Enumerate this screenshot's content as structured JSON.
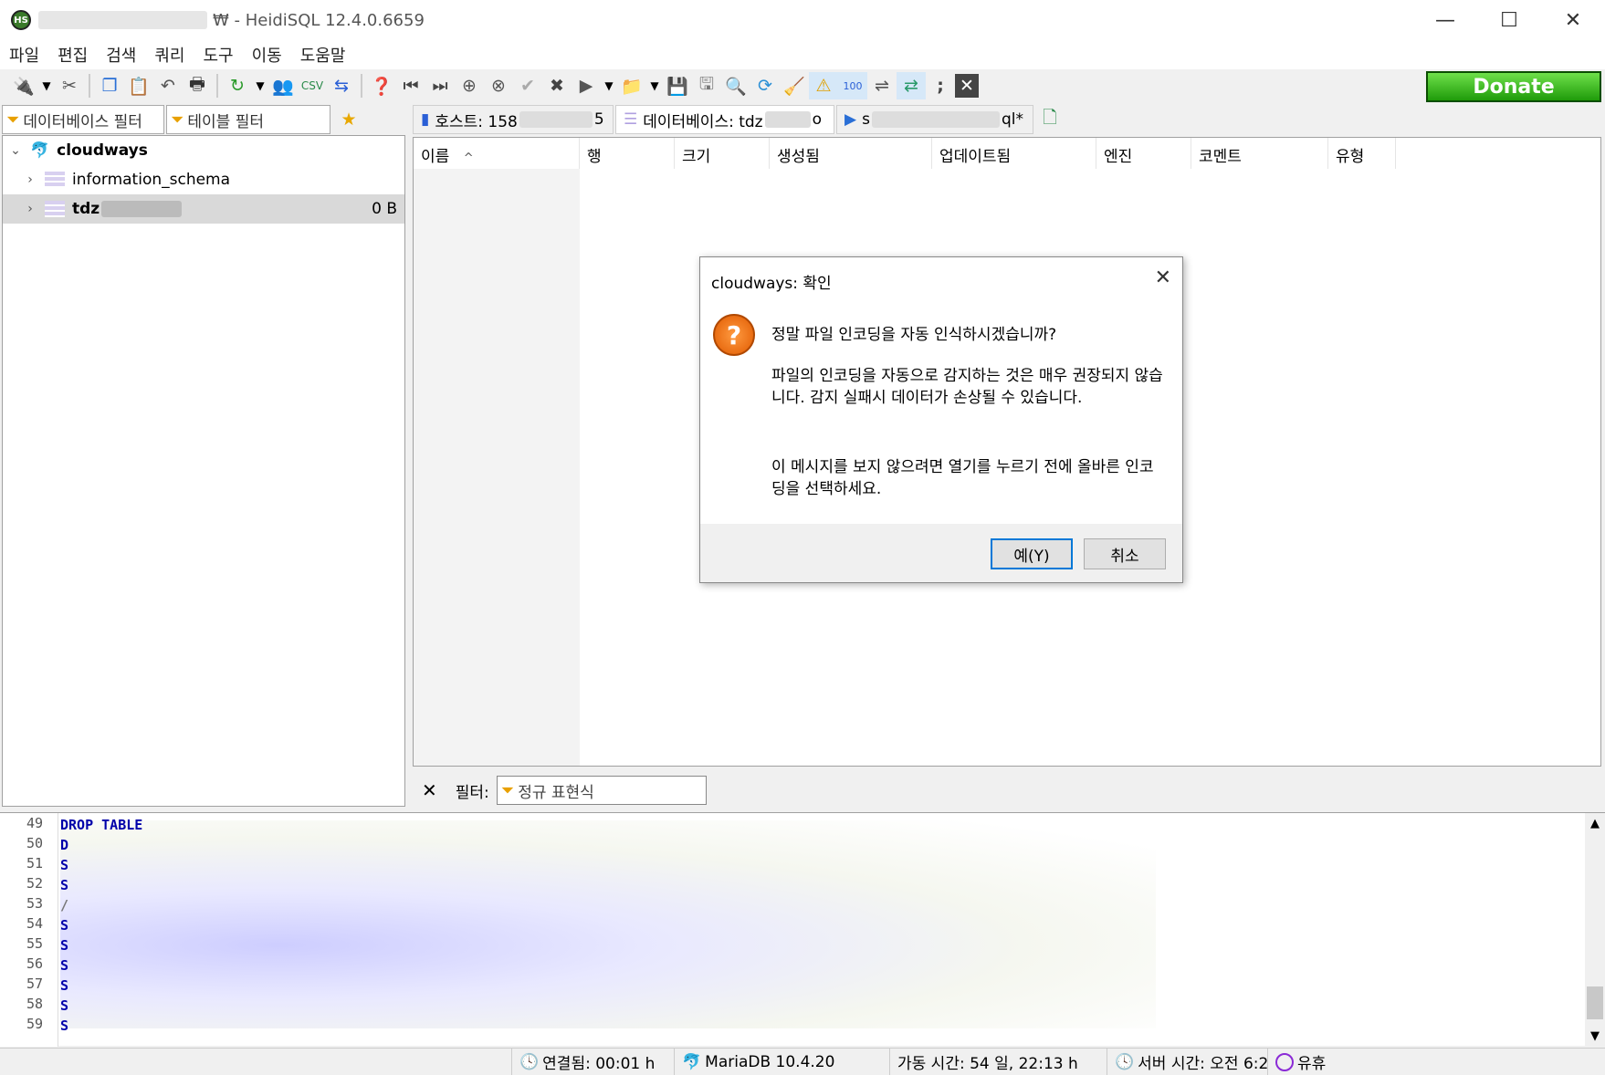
{
  "window": {
    "title": "₩ - HeidiSQL 12.4.0.6659",
    "app_icon_text": "HS",
    "minimize": "—",
    "maximize": "☐",
    "close": "✕"
  },
  "menu": [
    "파일",
    "편집",
    "검색",
    "쿼리",
    "도구",
    "이동",
    "도움말"
  ],
  "toolbar": {
    "donate_label": "Donate"
  },
  "filters": {
    "db_filter": "데이터베이스 필터",
    "table_filter": "테이블 필터"
  },
  "tree": {
    "root": "cloudways",
    "items": [
      {
        "label": "information_schema",
        "size": ""
      },
      {
        "label": "tdz",
        "size": "0 B"
      }
    ]
  },
  "tabs": [
    {
      "prefix": "호스트: 158",
      "suffix": "5"
    },
    {
      "prefix": "데이터베이스: tdz",
      "suffix": "o"
    },
    {
      "prefix": "s",
      "suffix": "ql*"
    }
  ],
  "grid": {
    "columns": [
      "이름",
      "행",
      "크기",
      "생성됨",
      "업데이트됨",
      "엔진",
      "코멘트",
      "유형"
    ],
    "sort_indicator": "^"
  },
  "grid_filter": {
    "label": "필터:",
    "placeholder": "정규 표현식",
    "close": "✕"
  },
  "editor": {
    "line_numbers": [
      "49",
      "50",
      "51",
      "52",
      "53",
      "54",
      "55",
      "56",
      "57",
      "58",
      "59"
    ],
    "first_chars": [
      "DROP TABLE",
      "D",
      "S",
      "S",
      "/",
      "S",
      "S",
      "S",
      "S",
      "S",
      "S"
    ]
  },
  "status": {
    "connected": "연결됨: 00:01 h",
    "server": "MariaDB 10.4.20",
    "uptime": "가동 시간: 54 일, 22:13 h",
    "server_time": "서버 시간: 오전 6:2",
    "idle": "유휴"
  },
  "dialog": {
    "title": "cloudways: 확인",
    "question": "정말 파일 인코딩을 자동 인식하시겠습니까?",
    "warning": "파일의 인코딩을 자동으로 감지하는 것은 매우 권장되지 않습니다. 감지 실패시 데이터가 손상될 수 있습니다.",
    "hint": "이 메시지를 보지 않으려면 열기를 누르기 전에 올바른 인코딩을 선택하세요.",
    "yes_label": "예(Y)",
    "cancel_label": "취소"
  }
}
